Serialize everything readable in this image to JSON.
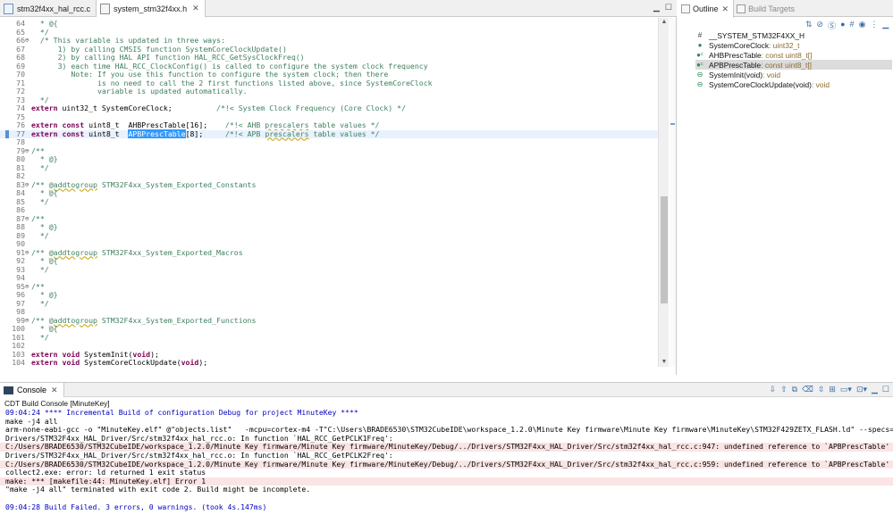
{
  "editor": {
    "tabs": [
      {
        "label": "stm32f4xx_hal_rcc.c",
        "icon": "c-file-icon",
        "active": false
      },
      {
        "label": "system_stm32f4xx.h",
        "icon": "h-file-icon",
        "active": true
      }
    ],
    "lines": [
      {
        "n": "64",
        "t": "  * @{"
      },
      {
        "n": "65",
        "t": "  */"
      },
      {
        "n": "66",
        "fold": "⊖",
        "t": "  /* This variable is updated in three ways:"
      },
      {
        "n": "67",
        "t": "      1) by calling CMSIS function SystemCoreClockUpdate()"
      },
      {
        "n": "68",
        "t": "      2) by calling HAL API function HAL_RCC_GetSysClockFreq()"
      },
      {
        "n": "69",
        "t": "      3) each time HAL_RCC_ClockConfig() is called to configure the system clock frequency"
      },
      {
        "n": "70",
        "t": "         Note: If you use this function to configure the system clock; then there"
      },
      {
        "n": "71",
        "t": "               is no need to call the 2 first functions listed above, since SystemCoreClock"
      },
      {
        "n": "72",
        "t": "               variable is updated automatically."
      },
      {
        "n": "73",
        "t": "  */"
      },
      {
        "n": "74",
        "t": "extern uint32_t SystemCoreClock;          /*!< System Clock Frequency (Core Clock) */"
      },
      {
        "n": "75",
        "t": ""
      },
      {
        "n": "76",
        "t": "extern const uint8_t  AHBPrescTable[16];    /*!< AHB prescalers table values */"
      },
      {
        "n": "77",
        "t": "extern const uint8_t  APBPrescTable[8];     /*!< APB prescalers table values */"
      },
      {
        "n": "78",
        "t": ""
      },
      {
        "n": "79",
        "fold": "⊖",
        "t": "/**"
      },
      {
        "n": "80",
        "t": "  * @}"
      },
      {
        "n": "81",
        "t": "  */"
      },
      {
        "n": "82",
        "t": ""
      },
      {
        "n": "83",
        "fold": "⊖",
        "t": "/** @addtogroup STM32F4xx_System_Exported_Constants"
      },
      {
        "n": "84",
        "t": "  * @{"
      },
      {
        "n": "85",
        "t": "  */"
      },
      {
        "n": "86",
        "t": ""
      },
      {
        "n": "87",
        "fold": "⊖",
        "t": "/**"
      },
      {
        "n": "88",
        "t": "  * @}"
      },
      {
        "n": "89",
        "t": "  */"
      },
      {
        "n": "90",
        "t": ""
      },
      {
        "n": "91",
        "fold": "⊖",
        "t": "/** @addtogroup STM32F4xx_System_Exported_Macros"
      },
      {
        "n": "92",
        "t": "  * @{"
      },
      {
        "n": "93",
        "t": "  */"
      },
      {
        "n": "94",
        "t": ""
      },
      {
        "n": "95",
        "fold": "⊖",
        "t": "/**"
      },
      {
        "n": "96",
        "t": "  * @}"
      },
      {
        "n": "97",
        "t": "  */"
      },
      {
        "n": "98",
        "t": ""
      },
      {
        "n": "99",
        "fold": "⊖",
        "t": "/** @addtogroup STM32F4xx_System_Exported_Functions"
      },
      {
        "n": "100",
        "t": "  * @{"
      },
      {
        "n": "101",
        "t": "  */"
      },
      {
        "n": "102",
        "t": ""
      },
      {
        "n": "103",
        "t": "extern void SystemInit(void);"
      },
      {
        "n": "104",
        "t": "extern void SystemCoreClockUpdate(void);"
      }
    ],
    "current_line": "77",
    "selected_text": "APBPrescTable"
  },
  "outline": {
    "tabs": [
      {
        "label": "Outline",
        "active": true
      },
      {
        "label": "Build Targets",
        "active": false
      }
    ],
    "toolbar_icons": [
      "sort-icon",
      "hide-fields-icon",
      "hide-static-icon",
      "hide-nonpublic-icon",
      "hide-macros-icon",
      "focus-icon",
      "link-icon",
      "view-menu-icon"
    ],
    "items": [
      {
        "icon": "#",
        "name": "__SYSTEM_STM32F4XX_H",
        "type": "",
        "selected": false
      },
      {
        "icon": "●",
        "name": "SystemCoreClock",
        "type": " : uint32_t",
        "selected": false
      },
      {
        "icon": "●ᶜ",
        "name": "AHBPrescTable",
        "type": " : const uint8_t[]",
        "selected": false
      },
      {
        "icon": "●ᶜ",
        "name": "APBPrescTable",
        "type": " : const uint8_t[]",
        "selected": true
      },
      {
        "icon": "⊖",
        "name": "SystemInit(void)",
        "type": " : void",
        "selected": false
      },
      {
        "icon": "⊖",
        "name": "SystemCoreClockUpdate(void)",
        "type": " : void",
        "selected": false
      }
    ]
  },
  "console": {
    "tab_label": "Console",
    "title": "CDT Build Console [MinuteKey]",
    "lines": [
      {
        "kind": "info",
        "t": "09:04:24 **** Incremental Build of configuration Debug for project MinuteKey ****"
      },
      {
        "kind": "plain",
        "t": "make -j4 all"
      },
      {
        "kind": "plain",
        "t": "arm-none-eabi-gcc -o \"MinuteKey.elf\" @\"objects.list\"   -mcpu=cortex-m4 -T\"C:\\Users\\BRADE6530\\STM32CubeIDE\\workspace_1.2.0\\Minute Key firmware\\Minute Key firmware\\MinuteKey\\STM32F429ZETX_FLASH.ld\" --specs=nosys.specs -Wl,"
      },
      {
        "kind": "plain",
        "t": "Drivers/STM32F4xx_HAL_Driver/Src/stm32f4xx_hal_rcc.o: In function `HAL_RCC_GetPCLK1Freq':"
      },
      {
        "kind": "err",
        "t": "C:/Users/BRADE6530/STM32CubeIDE/workspace_1.2.0/Minute Key firmware/Minute Key firmware/MinuteKey/Debug/../Drivers/STM32F4xx_HAL_Driver/Src/stm32f4xx_hal_rcc.c:947: undefined reference to `APBPrescTable'"
      },
      {
        "kind": "plain",
        "t": "Drivers/STM32F4xx_HAL_Driver/Src/stm32f4xx_hal_rcc.o: In function `HAL_RCC_GetPCLK2Freq':"
      },
      {
        "kind": "err",
        "t": "C:/Users/BRADE6530/STM32CubeIDE/workspace_1.2.0/Minute Key firmware/Minute Key firmware/MinuteKey/Debug/../Drivers/STM32F4xx_HAL_Driver/Src/stm32f4xx_hal_rcc.c:959: undefined reference to `APBPrescTable'"
      },
      {
        "kind": "plain",
        "t": "collect2.exe: error: ld returned 1 exit status"
      },
      {
        "kind": "err",
        "t": "make: *** [makefile:44: MinuteKey.elf] Error 1"
      },
      {
        "kind": "plain",
        "t": "\"make -j4 all\" terminated with exit code 2. Build might be incomplete."
      },
      {
        "kind": "plain",
        "t": ""
      },
      {
        "kind": "info",
        "t": "09:04:28 Build Failed. 3 errors, 0 warnings. (took 4s.147ms)"
      }
    ],
    "toolbar_icons": [
      "scroll-lock-icon",
      "next-error-icon",
      "prev-error-icon",
      "clear-icon",
      "pin-icon",
      "display-console-icon",
      "open-console-icon",
      "minimize-icon",
      "maximize-icon"
    ]
  }
}
